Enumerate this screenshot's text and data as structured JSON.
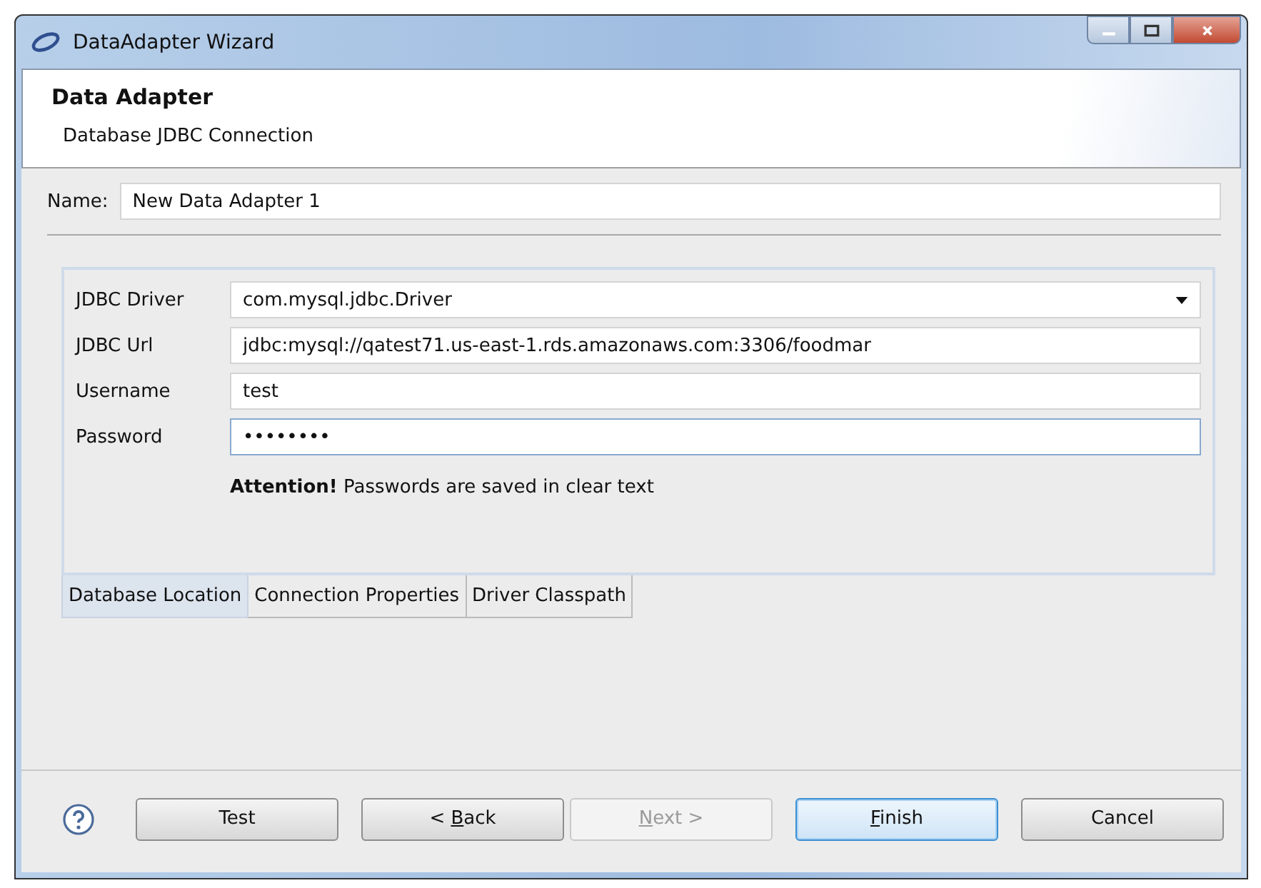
{
  "window": {
    "title": "DataAdapter Wizard"
  },
  "header": {
    "title": "Data Adapter",
    "subtitle": "Database JDBC Connection"
  },
  "name_field": {
    "label": "Name:",
    "value": "New Data Adapter 1"
  },
  "fields": [
    {
      "kind": "dropdown",
      "label": "JDBC Driver",
      "value": "com.mysql.jdbc.Driver",
      "focused": false
    },
    {
      "kind": "text",
      "label": "JDBC Url",
      "value": "jdbc:mysql://qatest71.us-east-1.rds.amazonaws.com:3306/foodmar",
      "focused": false
    },
    {
      "kind": "text",
      "label": "Username",
      "value": "test",
      "focused": false
    },
    {
      "kind": "text",
      "label": "Password",
      "value": "••••••••",
      "focused": true
    }
  ],
  "notice": "**Attention!** Passwords are saved in clear text",
  "tabs": [
    {
      "label": "Database Location",
      "selected": true
    },
    {
      "label": "Connection Properties",
      "selected": false
    },
    {
      "label": "Driver Classpath",
      "selected": false
    }
  ],
  "buttons": [
    {
      "label": [
        {
          "text": "Test",
          "underline": false
        }
      ],
      "disabled": false,
      "default": false
    },
    {
      "label": [
        {
          "text": "< ",
          "underline": false
        },
        {
          "text": "B",
          "underline": true
        },
        {
          "text": "ack",
          "underline": false
        }
      ],
      "disabled": false,
      "default": false
    },
    {
      "label": [
        {
          "text": "N",
          "underline": true
        },
        {
          "text": "ext >",
          "underline": false
        }
      ],
      "disabled": true,
      "default": false
    },
    {
      "label": [
        {
          "text": "F",
          "underline": true
        },
        {
          "text": "inish",
          "underline": false
        }
      ],
      "disabled": false,
      "default": true
    },
    {
      "label": [
        {
          "text": "Cancel",
          "underline": false
        }
      ],
      "disabled": false,
      "default": false
    }
  ]
}
